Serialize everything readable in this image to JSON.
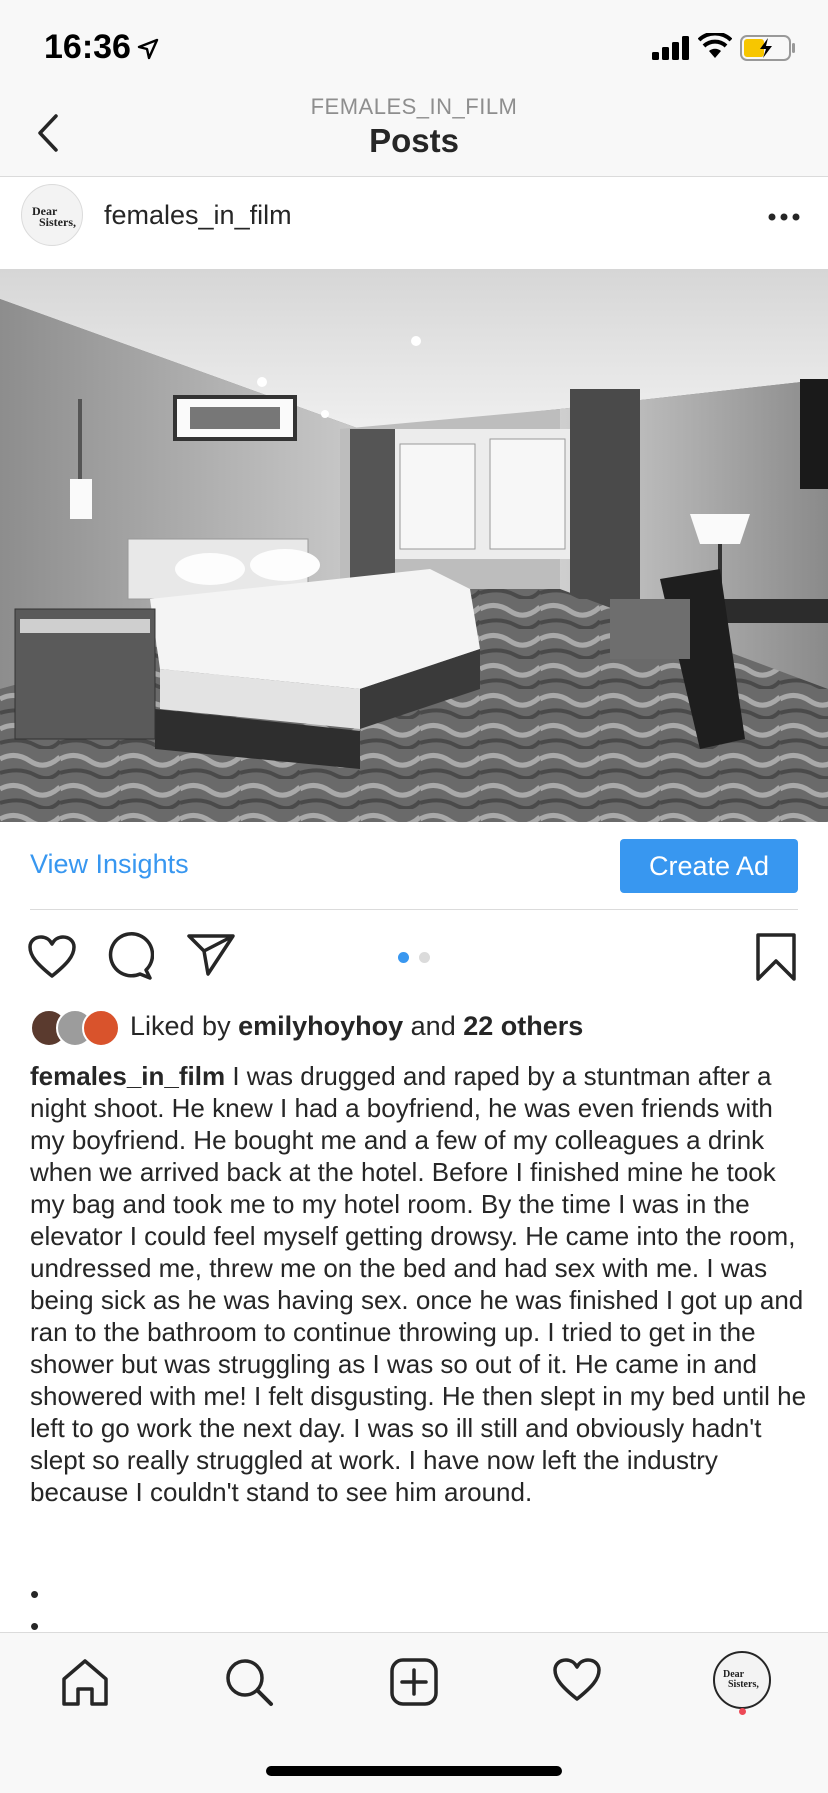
{
  "status_bar": {
    "time": "16:36",
    "battery_color": "#f7c600"
  },
  "nav": {
    "subtitle": "FEMALES_IN_FILM",
    "title": "Posts"
  },
  "post": {
    "username": "females_in_film",
    "avatar_text": [
      "Dear",
      "Sisters,"
    ],
    "image_alt": "hotel room with bed",
    "insights_label": "View Insights",
    "create_ad_label": "Create Ad",
    "carousel": {
      "count": 2,
      "active": 0
    },
    "likes": {
      "prefix": "Liked by",
      "user": "emilyhoyhoy",
      "conj": "and",
      "others": "22 others"
    },
    "caption_user": "females_in_film",
    "caption_text": "I was drugged and raped by a stuntman after a night shoot. He knew I had a boyfriend, he was even friends with my boyfriend. He bought me and a few of my colleagues a drink when we arrived back at the hotel. Before I finished mine he took my bag and took me to my hotel room. By the time I was in the elevator I could feel myself getting drowsy. He came into the room, undressed me, threw me on the bed and had sex with me. I was being sick as he was having sex. once he was finished I got up and ran to the bathroom to continue throwing up. I tried to get in the shower but was struggling as I was so out of it. He came in and showered with me! I felt disgusting. He then slept in my bed until he left to go work the next day. I was so ill still and obviously hadn't slept so really struggled at work. I have now left the industry because I couldn't stand to see him around.",
    "bullets": [
      "•",
      "•"
    ]
  },
  "tabs": [
    "home-icon",
    "search-icon",
    "new-post-icon",
    "activity-icon",
    "profile-avatar"
  ],
  "colors": {
    "accent": "#3897f0",
    "notification": "#ed4956"
  }
}
